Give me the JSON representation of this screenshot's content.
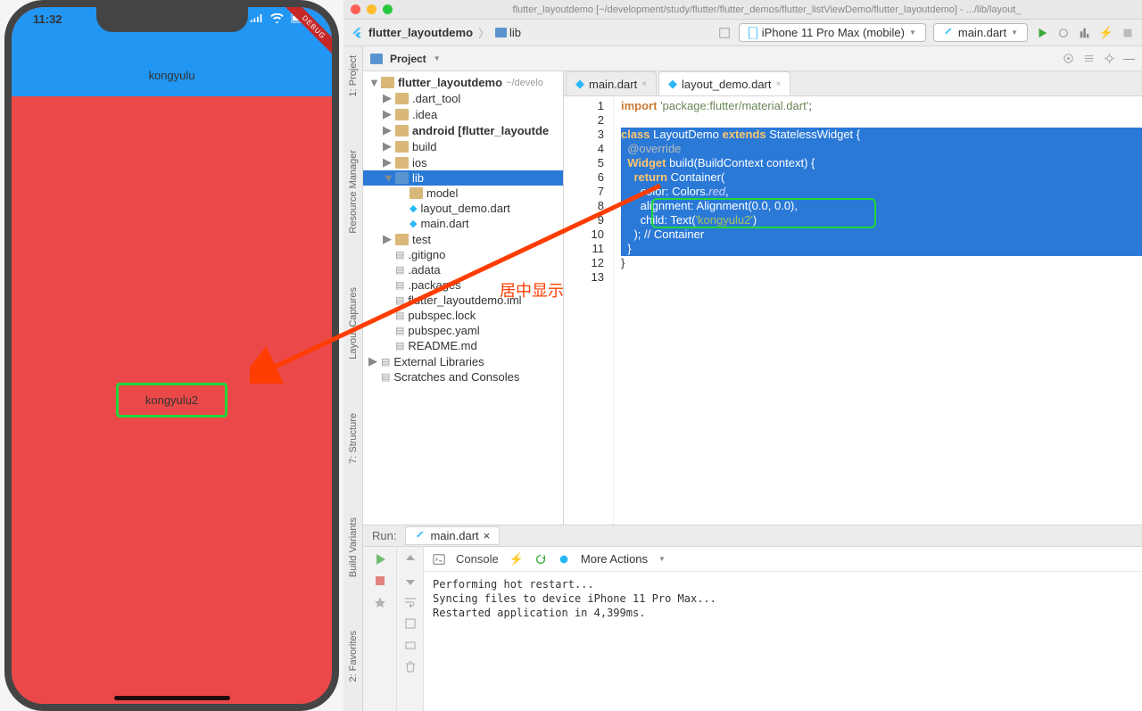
{
  "phone": {
    "time": "11:32",
    "appbar_title": "kongyulu",
    "center_text": "kongyulu2",
    "debug": "DEBUG"
  },
  "ide": {
    "title": "flutter_layoutdemo [~/development/study/flutter/flutter_demos/flutter_listViewDemo/flutter_layoutdemo] - .../lib/layout_",
    "breadcrumb": {
      "project": "flutter_layoutdemo",
      "folder": "lib"
    },
    "toolbar": {
      "device": "iPhone 11 Pro Max (mobile)",
      "config": "main.dart"
    },
    "project_label": "Project",
    "sidebar_tabs": [
      "1: Project",
      "Resource Manager",
      "Layout Captures",
      "7: Structure",
      "Build Variants",
      "2: Favorites"
    ],
    "tree": {
      "root": {
        "name": "flutter_layoutdemo",
        "suffix": "~/develo"
      },
      "nodes": [
        {
          "name": ".dart_tool",
          "type": "folder",
          "depth": 1,
          "arrow": "▶"
        },
        {
          "name": ".idea",
          "type": "folder",
          "depth": 1,
          "arrow": "▶"
        },
        {
          "name": "android [flutter_layoutde",
          "type": "folder",
          "depth": 1,
          "arrow": "▶",
          "bold": true
        },
        {
          "name": "build",
          "type": "folder",
          "depth": 1,
          "arrow": "▶"
        },
        {
          "name": "ios",
          "type": "folder",
          "depth": 1,
          "arrow": "▶"
        },
        {
          "name": "lib",
          "type": "folder2",
          "depth": 1,
          "arrow": "▼",
          "sel": true
        },
        {
          "name": "model",
          "type": "folder",
          "depth": 2,
          "arrow": ""
        },
        {
          "name": "layout_demo.dart",
          "type": "dart",
          "depth": 2,
          "arrow": ""
        },
        {
          "name": "main.dart",
          "type": "dart",
          "depth": 2,
          "arrow": ""
        },
        {
          "name": "test",
          "type": "folder",
          "depth": 1,
          "arrow": "▶"
        },
        {
          "name": ".gitigno",
          "type": "file",
          "depth": 1,
          "arrow": ""
        },
        {
          "name": ".adata",
          "type": "file",
          "depth": 1,
          "arrow": "",
          "prefix": " "
        },
        {
          "name": ".packages",
          "type": "file",
          "depth": 1,
          "arrow": ""
        },
        {
          "name": "flutter_layoutdemo.iml",
          "type": "file",
          "depth": 1,
          "arrow": ""
        },
        {
          "name": "pubspec.lock",
          "type": "file",
          "depth": 1,
          "arrow": ""
        },
        {
          "name": "pubspec.yaml",
          "type": "file",
          "depth": 1,
          "arrow": ""
        },
        {
          "name": "README.md",
          "type": "file",
          "depth": 1,
          "arrow": ""
        }
      ],
      "ext_lib": "External Libraries",
      "scratches": "Scratches and Consoles"
    },
    "tabs": [
      {
        "label": "main.dart",
        "active": false
      },
      {
        "label": "layout_demo.dart",
        "active": true
      }
    ],
    "line_numbers": [
      "1",
      "2",
      "3",
      "4",
      "5",
      "6",
      "7",
      "8",
      "9",
      "10",
      "11",
      "12",
      "13"
    ],
    "code": [
      {
        "text": "import 'package:flutter/material.dart';",
        "hl": false
      },
      {
        "text": "",
        "hl": false
      },
      {
        "text": "class LayoutDemo extends StatelessWidget {",
        "hl": true
      },
      {
        "text": "  @override",
        "hl": true
      },
      {
        "text": "  Widget build(BuildContext context) {",
        "hl": true
      },
      {
        "text": "    return Container(",
        "hl": true
      },
      {
        "text": "      color: Colors.red,",
        "hl": true
      },
      {
        "text": "      alignment: Alignment(0.0, 0.0),",
        "hl": true
      },
      {
        "text": "      child: Text('kongyulu2')",
        "hl": true
      },
      {
        "text": "    ); // Container",
        "hl": true
      },
      {
        "text": "  }",
        "hl": true
      },
      {
        "text": "}",
        "hl": false
      },
      {
        "text": "",
        "hl": false
      }
    ],
    "run": {
      "label": "Run:",
      "tab": "main.dart",
      "console_label": "Console",
      "more": "More Actions",
      "output": "Performing hot restart...\nSyncing files to device iPhone 11 Pro Max...\nRestarted application in 4,399ms."
    }
  },
  "annotation": {
    "text": "居中显示"
  }
}
